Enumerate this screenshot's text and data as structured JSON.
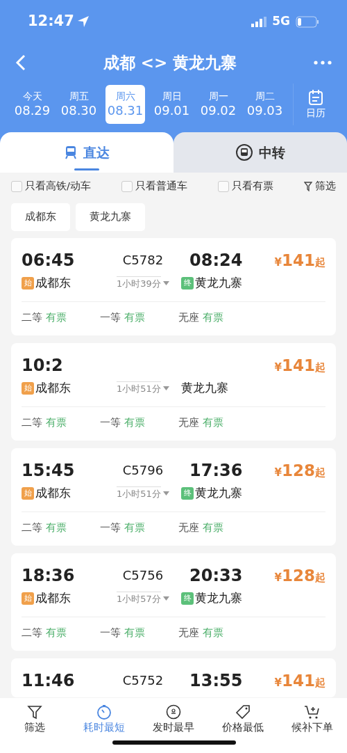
{
  "status_bar": {
    "time": "12:47",
    "network": "5G"
  },
  "header": {
    "title": "成都 <> 黄龙九寨"
  },
  "dates": [
    {
      "weekday": "今天",
      "date": "08.29",
      "selected": false
    },
    {
      "weekday": "周五",
      "date": "08.30",
      "selected": false
    },
    {
      "weekday": "周六",
      "date": "08.31",
      "selected": true
    },
    {
      "weekday": "周日",
      "date": "09.01",
      "selected": false
    },
    {
      "weekday": "周一",
      "date": "09.02",
      "selected": false
    },
    {
      "weekday": "周二",
      "date": "09.03",
      "selected": false
    }
  ],
  "calendar_label": "日历",
  "tabs": [
    {
      "label": "直达",
      "selected": true
    },
    {
      "label": "中转",
      "selected": false
    }
  ],
  "filters": [
    {
      "label": "只看高铁/动车",
      "checked": false
    },
    {
      "label": "只看普通车",
      "checked": false
    },
    {
      "label": "只看有票",
      "checked": false
    }
  ],
  "filter_link": "筛选",
  "stations": [
    "成都东",
    "黄龙九寨"
  ],
  "trains": [
    {
      "depart": "06:45",
      "train_no": "C5782",
      "arrive": "08:24",
      "currency": "¥",
      "price": "141",
      "price_suffix": "起",
      "from_tag": "始",
      "from": "成都东",
      "duration": "1小时39分",
      "to_tag": "终",
      "to": "黄龙九寨",
      "seats": [
        {
          "class": "二等",
          "status": "有票"
        },
        {
          "class": "一等",
          "status": "有票"
        },
        {
          "class": "无座",
          "status": "有票"
        }
      ]
    },
    {
      "depart": "10:2",
      "currency": "¥",
      "price": "141",
      "price_suffix": "起",
      "from_tag": "始",
      "from": "成都东",
      "duration": "1小时51分",
      "to": "黄龙九寨",
      "seats": [
        {
          "class": "二等",
          "status": "有票"
        },
        {
          "class": "一等",
          "status": "有票"
        },
        {
          "class": "无座",
          "status": "有票"
        }
      ]
    },
    {
      "depart": "15:45",
      "train_no": "C5796",
      "arrive": "17:36",
      "currency": "¥",
      "price": "128",
      "price_suffix": "起",
      "from_tag": "始",
      "from": "成都东",
      "duration": "1小时51分",
      "to_tag": "终",
      "to": "黄龙九寨",
      "seats": [
        {
          "class": "二等",
          "status": "有票"
        },
        {
          "class": "一等",
          "status": "有票"
        },
        {
          "class": "无座",
          "status": "有票"
        }
      ]
    },
    {
      "depart": "18:36",
      "train_no": "C5756",
      "arrive": "20:33",
      "currency": "¥",
      "price": "128",
      "price_suffix": "起",
      "from_tag": "始",
      "from": "成都东",
      "duration": "1小时57分",
      "to_tag": "终",
      "to": "黄龙九寨",
      "seats": [
        {
          "class": "二等",
          "status": "有票"
        },
        {
          "class": "一等",
          "status": "有票"
        },
        {
          "class": "无座",
          "status": "有票"
        }
      ]
    },
    {
      "depart": "11:46",
      "train_no": "C5752",
      "arrive": "13:55",
      "currency": "¥",
      "price": "141",
      "price_suffix": "起"
    }
  ],
  "bottom_nav": [
    {
      "label": "筛选",
      "kind": "filter",
      "selected": false
    },
    {
      "label": "耗时最短",
      "kind": "timer",
      "selected": true
    },
    {
      "label": "发时最早",
      "kind": "clock24",
      "selected": false
    },
    {
      "label": "价格最低",
      "kind": "tag",
      "selected": false
    },
    {
      "label": "候补下单",
      "kind": "cart",
      "selected": false
    }
  ]
}
